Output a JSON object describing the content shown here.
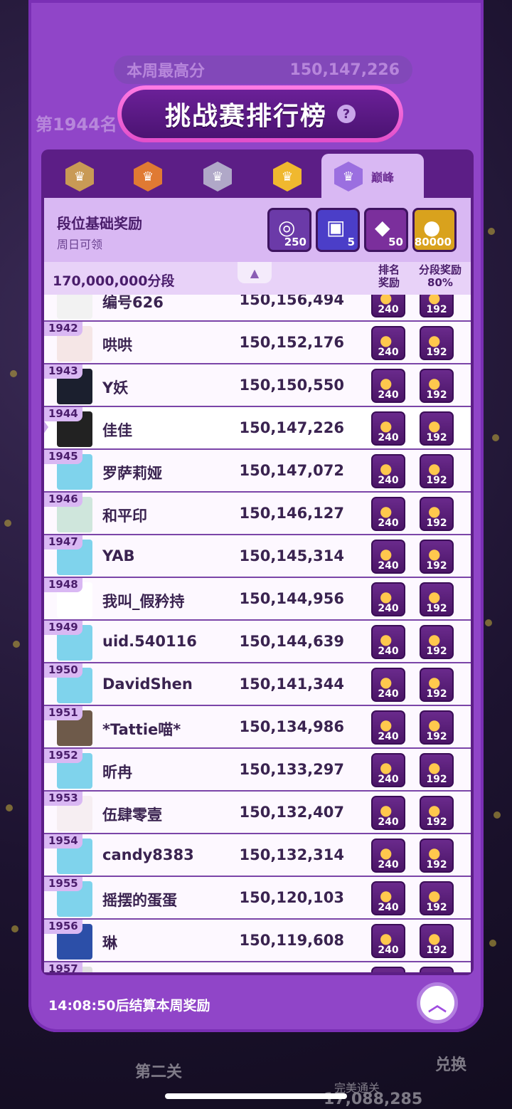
{
  "background": {
    "rank": "第1944名",
    "best_label": "本周最高分",
    "best_value": "150,147,226",
    "bottom_left": "第二关",
    "bottom_mid_label": "完美通关",
    "bottom_mid_value": "17,088,285",
    "bottom_right": "兑换"
  },
  "header": {
    "title": "挑战赛排行榜",
    "help": "?"
  },
  "tabs": [
    {
      "icon": "bronze-crown-badge",
      "color": "#c99a55"
    },
    {
      "icon": "orange-crown-badge",
      "color": "#e07a33"
    },
    {
      "icon": "silver-crown-badge",
      "color": "#b0a8c8"
    },
    {
      "icon": "gold-crown-badge",
      "color": "#f0b82f"
    },
    {
      "icon": "purple-crown-badge",
      "color": "#9b6fe0",
      "label": "巅峰"
    }
  ],
  "rewards": {
    "title": "段位基础奖励",
    "subtitle": "周日可领",
    "items": [
      {
        "icon": "purple-coins-icon",
        "count": "250",
        "color": "#6b3aa8"
      },
      {
        "icon": "photo-card-icon",
        "count": "5",
        "color": "#4b3ec8"
      },
      {
        "icon": "purple-gems-icon",
        "count": "50",
        "color": "#7b2f9c"
      },
      {
        "icon": "gold-coins-icon",
        "count": "80000",
        "color": "#d9a21d"
      }
    ]
  },
  "section": {
    "label": "170,000,000分段",
    "col_rank_reward": "排名\n奖励",
    "col_tier_reward_l1": "分段奖励",
    "col_tier_reward_l2": "80%"
  },
  "rows": [
    {
      "rank": "",
      "name": "编号626",
      "score": "150,156,494",
      "r1": "240",
      "r2": "192",
      "avatar": "#f2f2f2"
    },
    {
      "rank": "1942",
      "name": "哄哄",
      "score": "150,152,176",
      "r1": "240",
      "r2": "192",
      "avatar": "#f5e6e6"
    },
    {
      "rank": "1943",
      "name": "Y妖",
      "score": "150,150,550",
      "r1": "240",
      "r2": "192",
      "avatar": "#1b1f2e"
    },
    {
      "rank": "1944",
      "name": "佳佳",
      "score": "150,147,226",
      "r1": "240",
      "r2": "192",
      "avatar": "#222222"
    },
    {
      "rank": "1945",
      "name": "罗萨莉娅",
      "score": "150,147,072",
      "r1": "240",
      "r2": "192",
      "avatar": "#7fd3ec"
    },
    {
      "rank": "1946",
      "name": "和平印",
      "score": "150,146,127",
      "r1": "240",
      "r2": "192",
      "avatar": "#cfe6dc"
    },
    {
      "rank": "1947",
      "name": "YAB",
      "score": "150,145,314",
      "r1": "240",
      "r2": "192",
      "avatar": "#7fd3ec"
    },
    {
      "rank": "1948",
      "name": "我叫_假矜持",
      "score": "150,144,956",
      "r1": "240",
      "r2": "192",
      "avatar": "#ffffff"
    },
    {
      "rank": "1949",
      "name": "uid.540116",
      "score": "150,144,639",
      "r1": "240",
      "r2": "192",
      "avatar": "#7fd3ec"
    },
    {
      "rank": "1950",
      "name": "DavidShen",
      "score": "150,141,344",
      "r1": "240",
      "r2": "192",
      "avatar": "#7fd3ec"
    },
    {
      "rank": "1951",
      "name": "*Tattie喵*",
      "score": "150,134,986",
      "r1": "240",
      "r2": "192",
      "avatar": "#6e5a4a"
    },
    {
      "rank": "1952",
      "name": "昕冉",
      "score": "150,133,297",
      "r1": "240",
      "r2": "192",
      "avatar": "#7fd3ec"
    },
    {
      "rank": "1953",
      "name": "伍肆零壹",
      "score": "150,132,407",
      "r1": "240",
      "r2": "192",
      "avatar": "#f6eef2"
    },
    {
      "rank": "1954",
      "name": "candy8383",
      "score": "150,132,314",
      "r1": "240",
      "r2": "192",
      "avatar": "#7fd3ec"
    },
    {
      "rank": "1955",
      "name": "摇摆的蛋蛋",
      "score": "150,120,103",
      "r1": "240",
      "r2": "192",
      "avatar": "#7fd3ec"
    },
    {
      "rank": "1956",
      "name": "琳",
      "score": "150,119,608",
      "r1": "240",
      "r2": "192",
      "avatar": "#2c4fa8"
    },
    {
      "rank": "1957",
      "name": "",
      "score": "",
      "r1": "",
      "r2": "",
      "avatar": "#e0e0e0"
    }
  ],
  "footer": {
    "countdown": "14:08:50后结算本周奖励"
  },
  "colors": {
    "panel": "#9045c8",
    "board": "#5c1e86",
    "accent_pink": "#e24fc9"
  }
}
